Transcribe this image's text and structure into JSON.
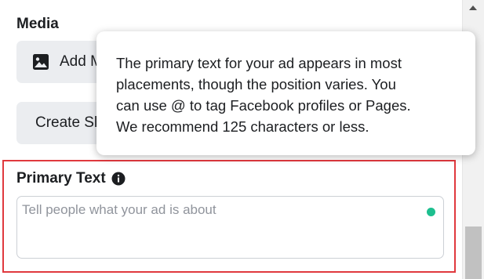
{
  "media": {
    "heading": "Media",
    "add_media_label": "Add Media",
    "create_label": "Create Slideshow"
  },
  "tooltip": {
    "line1": "The primary text for your ad appears in most",
    "line2": "placements, though the position varies. You",
    "line3": "can use @ to tag Facebook profiles or Pages.",
    "line4": "We recommend 125 characters or less."
  },
  "primary_text": {
    "label": "Primary Text",
    "placeholder": "Tell people what your ad is about"
  },
  "icons": {
    "add_media": "image-icon",
    "info": "info-icon",
    "status": "status-dot-icon",
    "scroll_up": "chevron-up-icon"
  },
  "colors": {
    "highlight_border": "#e0393e",
    "status_dot": "#1dbf8f",
    "button_bg": "#ebedf0"
  }
}
